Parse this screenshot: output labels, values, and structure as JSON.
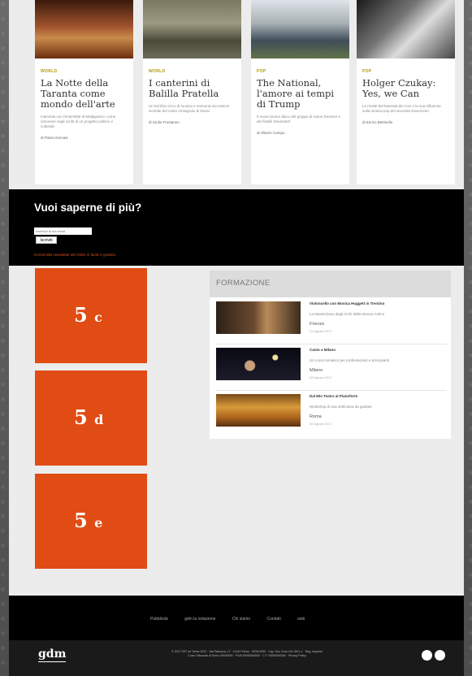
{
  "articles": [
    {
      "tag": "WORLD",
      "title": "La Notte della Taranta come mondo dell'arte",
      "excerpt": "Intervista con l'ensemble di Melpignano: come rinnovare negli scritti di un progetto politico e culturale",
      "author": "di Flavia Gervasi"
    },
    {
      "tag": "WORLD",
      "title": "I canterini di Balilla Pratella",
      "excerpt": "Un bel libro ricco di musica e memoria racconta le vicende del canto romagnolo di Russi",
      "author": "di Giulio Frustaneo"
    },
    {
      "tag": "POP",
      "title": "The National, l'amore ai tempi di Trump",
      "excerpt": "Il nuovo lavoro disco del gruppo di Aaron Dessner e dei fratelli Devendorf",
      "author": "di Alberto Campo"
    },
    {
      "tag": "POP",
      "title": "Holger Czukay: Yes, we Can",
      "excerpt": "Le ricette del bassista dei Can e la sua influenza sulla musica pop del secondo Novecento",
      "author": "di Enrico Bettinello"
    }
  ],
  "newsletter": {
    "heading": "Vuoi saperne di più?",
    "placeholder": "Inserisci la tua email",
    "button": "Iscriviti",
    "subtext": "Iscriviti alla newsletter del GDM. È facile e gratuito."
  },
  "tiles": [
    {
      "num": "5",
      "letter": "c"
    },
    {
      "num": "5",
      "letter": "d"
    },
    {
      "num": "5",
      "letter": "e"
    }
  ],
  "formazione": {
    "header": "FORMAZIONE",
    "items": [
      {
        "title": "Violoncello con Monica Huggett in Trentino",
        "desc": "La Masterclass degli Archi della Musica Antica",
        "city": "Firenze",
        "date": "31 Agosto 2017"
      },
      {
        "title": "Canto a Milano",
        "desc": "Un corso tematico per professionisti e principianti",
        "city": "Milano",
        "date": "28 Agosto 2017"
      },
      {
        "title": "Dal Mio Teatro al Pianoforte",
        "desc": "Workshop di una settimana da gustare",
        "city": "Roma",
        "date": "28 Agosto 2017"
      }
    ]
  },
  "footer": {
    "links": [
      "Pubblicità",
      "gdm la redazione",
      "Chi siamo",
      "Contatti",
      "web"
    ],
    "logo": "gdm",
    "legal_1": "© 2017 EDT srl Torino 2012 · Via Pianezza, 17 · 10149 Torino · ISSN-0000 · Cap. Soc. Euro 101.000 i.v. · Reg. Imprese",
    "legal_2": "Corso Tribunale di Torino 00000000 · P.IVA 00000000000 · C.F. 00000000000 · Privacy Policy"
  },
  "colors": {
    "accent": "#e04c14",
    "tag": "#b39b00",
    "newsletter_bg": "#000000"
  }
}
